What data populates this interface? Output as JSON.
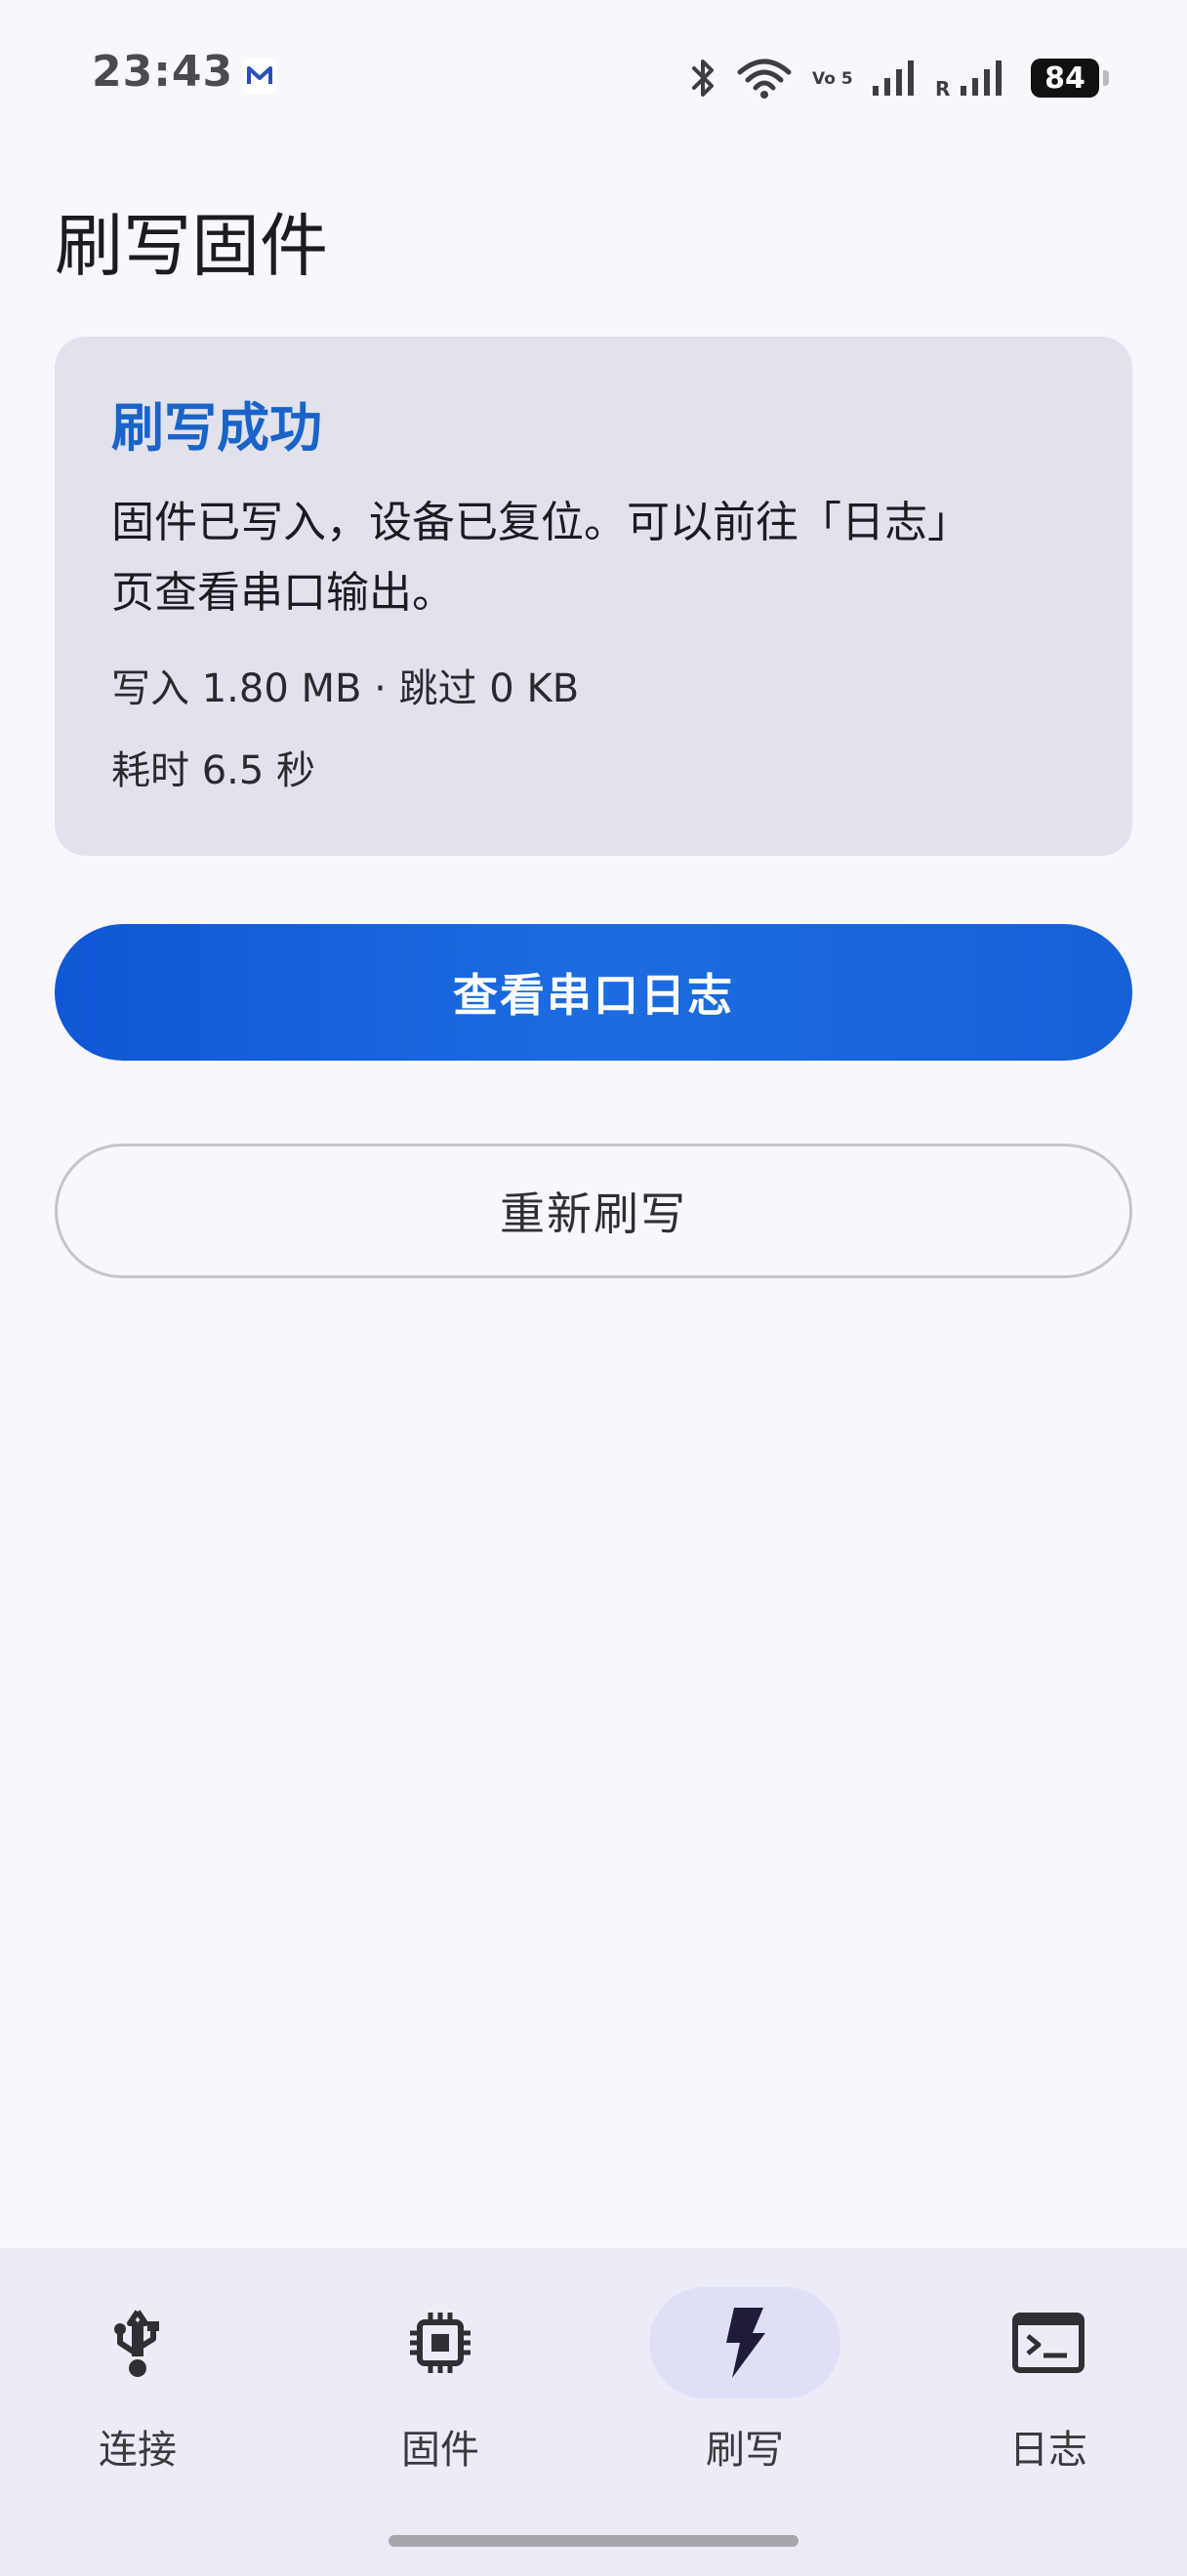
{
  "status_bar": {
    "time": "23:43",
    "battery": "84",
    "network_label": "Vo 5G",
    "roaming_label": "R"
  },
  "page": {
    "title": "刷写固件"
  },
  "result_card": {
    "title": "刷写成功",
    "message": "固件已写入，设备已复位。可以前往「日志」页查看串口输出。",
    "write_stats": "写入 1.80 MB · 跳过 0 KB",
    "elapsed": "耗时 6.5 秒"
  },
  "actions": {
    "view_log_label": "查看串口日志",
    "reflash_label": "重新刷写"
  },
  "bottom_nav": {
    "items": [
      {
        "label": "连接",
        "icon": "usb-icon",
        "active": false
      },
      {
        "label": "固件",
        "icon": "chip-icon",
        "active": false
      },
      {
        "label": "刷写",
        "icon": "flash-icon",
        "active": true
      },
      {
        "label": "日志",
        "icon": "terminal-icon",
        "active": false
      }
    ]
  },
  "colors": {
    "accent": "#1a63c8",
    "primary_button": "#1660d8",
    "card_bg": "#e1e2ec",
    "page_bg": "#f7f7fd",
    "nav_bg": "#ececf6",
    "active_indicator": "#dfdff7"
  }
}
